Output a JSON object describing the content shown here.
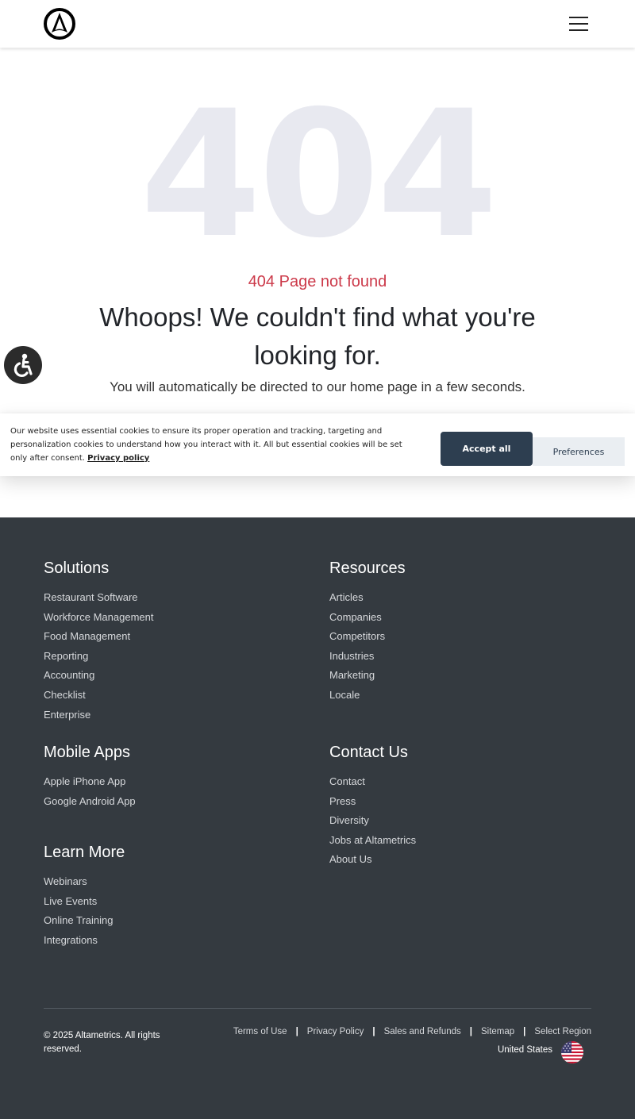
{
  "header": {
    "logo_icon": "altametrics-logo-icon",
    "menu_icon": "hamburger-menu-icon"
  },
  "error": {
    "code": "404",
    "subtitle": "404 Page not found",
    "headline": "Whoops! We couldn't find what you're looking for.",
    "redirect": "You will automatically be directed to our home page in a few seconds."
  },
  "accessibility": {
    "icon": "wheelchair-accessibility-icon"
  },
  "cookie": {
    "text": "Our website uses essential cookies to ensure its proper operation and tracking, targeting and personalization cookies to understand how you interact with it. All but essential cookies will be set only after consent.",
    "policy_link": "Privacy policy",
    "accept_label": "Accept all",
    "preferences_label": "Preferences"
  },
  "footer": {
    "solutions": {
      "title": "Solutions",
      "items": [
        "Restaurant Software",
        "Workforce Management",
        "Food Management",
        "Reporting",
        "Accounting",
        "Checklist",
        "Enterprise"
      ]
    },
    "resources": {
      "title": "Resources",
      "items": [
        "Articles",
        "Companies",
        "Competitors",
        "Industries",
        "Marketing",
        "Locale"
      ]
    },
    "mobile": {
      "title": "Mobile Apps",
      "items": [
        "Apple iPhone App",
        "Google Android App"
      ]
    },
    "contact": {
      "title": "Contact Us",
      "items": [
        "Contact",
        "Press",
        "Diversity",
        "Jobs at Altametrics",
        "About Us"
      ]
    },
    "learn": {
      "title": "Learn More",
      "items": [
        "Webinars",
        "Live Events",
        "Online Training",
        "Integrations"
      ]
    },
    "copyright": "© 2025 Altametrics. All rights reserved.",
    "legal": {
      "terms": "Terms of Use",
      "privacy": "Privacy Policy",
      "sales": "Sales and Refunds",
      "sitemap": "Sitemap",
      "region": "Select Region",
      "separator": "|"
    },
    "country": "United States",
    "flag_icon": "us-flag-icon"
  },
  "colors": {
    "accent_red": "#cc3a4a",
    "footer_bg": "#343a40",
    "button_dark": "#2d3e50",
    "watermark": "#e8e9f0"
  }
}
